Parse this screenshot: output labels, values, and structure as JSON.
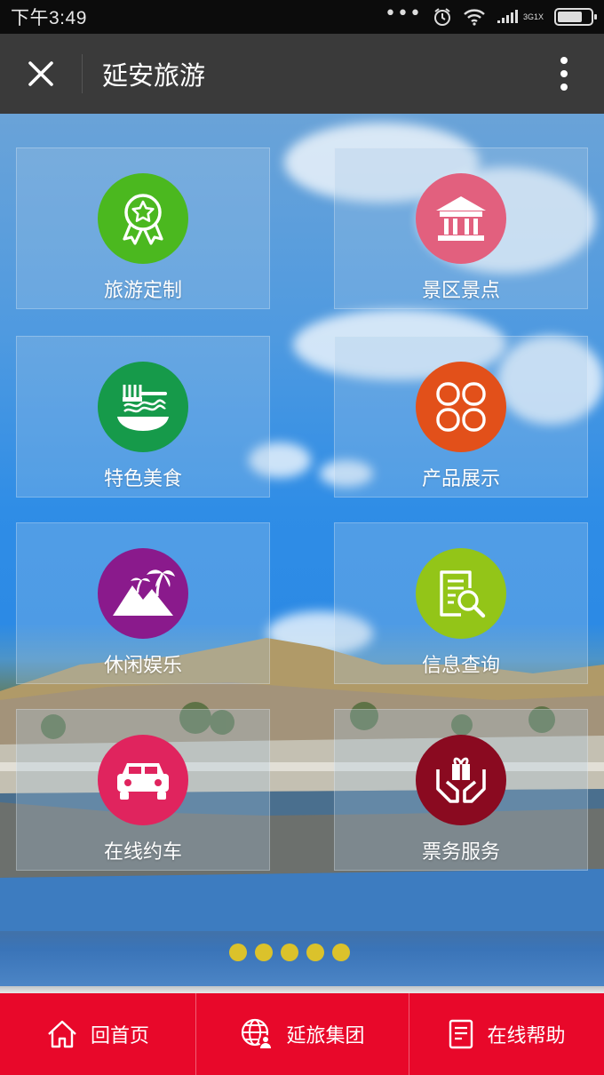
{
  "status_bar": {
    "time": "下午3:49",
    "network_top": "3G",
    "network_bottom": "1X",
    "battery_level": 0.75
  },
  "title_bar": {
    "title": "延安旅游",
    "close_icon": "close-icon",
    "more_icon": "more-vertical-icon"
  },
  "tiles": [
    {
      "label": "旅游定制",
      "icon": "award-ribbon-icon",
      "color": "#4bb81f"
    },
    {
      "label": "景区景点",
      "icon": "pavilion-icon",
      "color": "#e2607e"
    },
    {
      "label": "特色美食",
      "icon": "noodles-fork-icon",
      "color": "#169a4a"
    },
    {
      "label": "产品展示",
      "icon": "four-petal-icon",
      "color": "#e2501a"
    },
    {
      "label": "休闲娱乐",
      "icon": "palm-mountain-icon",
      "color": "#8a1a8c"
    },
    {
      "label": "信息查询",
      "icon": "document-search-icon",
      "color": "#93c518"
    },
    {
      "label": "在线约车",
      "icon": "car-icon",
      "color": "#e0245e"
    },
    {
      "label": "票务服务",
      "icon": "hands-gift-icon",
      "color": "#8a0a20"
    }
  ],
  "pager": {
    "count": 5,
    "color": "#e4c623"
  },
  "bottom_nav": [
    {
      "label": "回首页",
      "icon": "home-icon"
    },
    {
      "label": "延旅集团",
      "icon": "globe-user-icon"
    },
    {
      "label": "在线帮助",
      "icon": "help-document-icon"
    }
  ],
  "accent_color": "#e8082a"
}
